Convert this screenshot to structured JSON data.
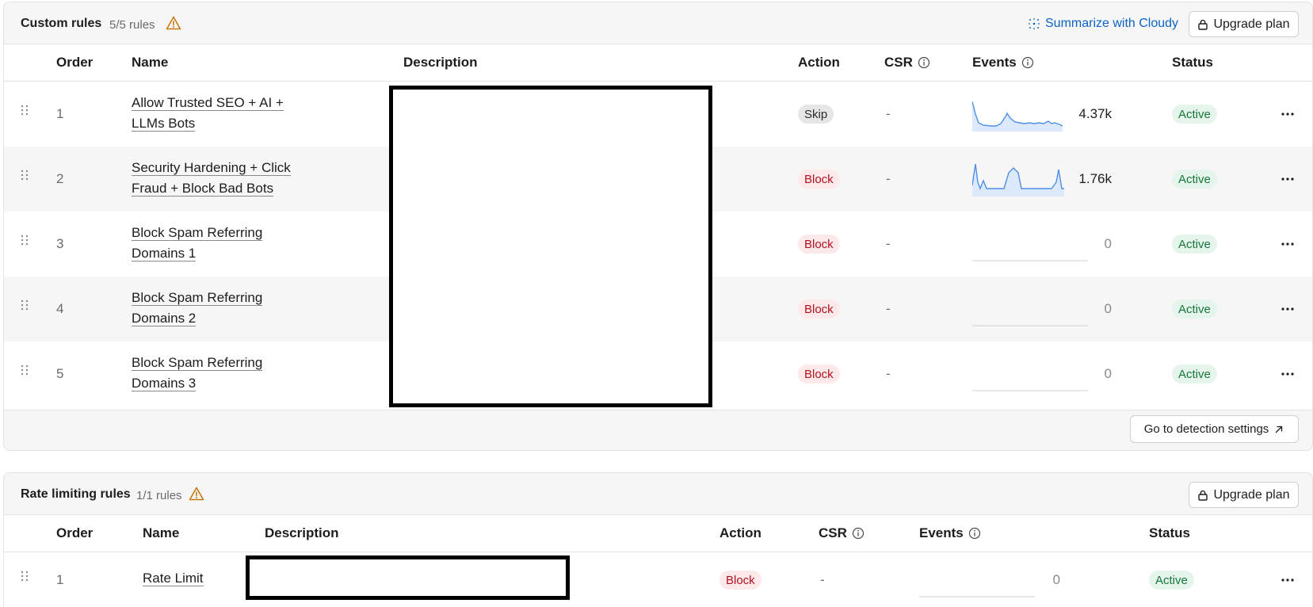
{
  "custom_rules": {
    "title": "Custom rules",
    "count": "5/5 rules",
    "summarize_label": "Summarize with Cloudy",
    "upgrade_label": "Upgrade plan",
    "detection_label": "Go to detection settings",
    "columns": {
      "order": "Order",
      "name": "Name",
      "description": "Description",
      "action": "Action",
      "csr": "CSR",
      "events": "Events",
      "status": "Status"
    },
    "rows": [
      {
        "order": "1",
        "name_line1": "Allow Trusted SEO + AI +",
        "name_line2": "LLMs Bots",
        "action": "Skip",
        "csr": "-",
        "events": "4.37k",
        "status": "Active"
      },
      {
        "order": "2",
        "name_line1": "Security Hardening + Click",
        "name_line2": "Fraud + Block Bad Bots",
        "action": "Block",
        "csr": "-",
        "events": "1.76k",
        "status": "Active"
      },
      {
        "order": "3",
        "name_line1": "Block Spam Referring",
        "name_line2": "Domains 1",
        "action": "Block",
        "csr": "-",
        "events": "0",
        "status": "Active"
      },
      {
        "order": "4",
        "name_line1": "Block Spam Referring",
        "name_line2": "Domains 2",
        "action": "Block",
        "csr": "-",
        "events": "0",
        "status": "Active"
      },
      {
        "order": "5",
        "name_line1": "Block Spam Referring",
        "name_line2": "Domains 3",
        "action": "Block",
        "csr": "-",
        "events": "0",
        "status": "Active"
      }
    ]
  },
  "rate_limiting_rules": {
    "title": "Rate limiting rules",
    "count": "1/1 rules",
    "upgrade_label": "Upgrade plan",
    "columns": {
      "order": "Order",
      "name": "Name",
      "description": "Description",
      "action": "Action",
      "csr": "CSR",
      "events": "Events",
      "status": "Status"
    },
    "rows": [
      {
        "order": "1",
        "name": "Rate Limit",
        "action": "Block",
        "csr": "-",
        "events": "0",
        "status": "Active"
      }
    ]
  },
  "colors": {
    "accent_link": "#0b63c5",
    "warning": "#c77a12",
    "block_text": "#b3121f",
    "active_text": "#16763a",
    "sparkline": "#4f8fe8"
  },
  "icons": [
    "warning-triangle-icon",
    "sparkle-icon",
    "lock-icon",
    "info-icon",
    "drag-handle-icon",
    "more-horizontal-icon",
    "external-arrow-icon"
  ]
}
